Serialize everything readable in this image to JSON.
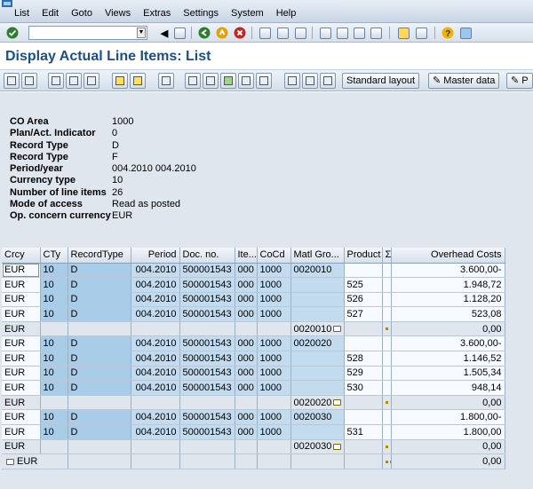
{
  "menu": [
    "List",
    "Edit",
    "Goto",
    "Views",
    "Extras",
    "Settings",
    "System",
    "Help"
  ],
  "title": "Display Actual Line Items: List",
  "appbar": {
    "standard_layout": "Standard layout",
    "master_data": "Master data",
    "cut_label": "P"
  },
  "header": [
    {
      "k": "CO Area",
      "v": "1000"
    },
    {
      "k": "Plan/Act. Indicator",
      "v": "0"
    },
    {
      "k": "Record Type",
      "v": "D"
    },
    {
      "k": "Record Type",
      "v": "F"
    },
    {
      "k": "Period/year",
      "v": "004.2010 004.2010"
    },
    {
      "k": "Currency type",
      "v": "10"
    },
    {
      "k": "Number of line items",
      "v": "26"
    },
    {
      "k": "Mode of access",
      "v": "Read as posted"
    },
    {
      "k": "Op. concern currency",
      "v": "EUR"
    }
  ],
  "columns": [
    "Crcy",
    "CTy",
    "RecordType",
    "Period",
    "Doc. no.",
    "Ite...",
    "CoCd",
    "Matl Gro...",
    "Product",
    "Σ",
    "Overhead Costs"
  ],
  "rows": [
    {
      "type": "row",
      "crcy": "EUR",
      "cty": "10",
      "rt": "D",
      "per": "004.2010",
      "doc": "500001543",
      "ite": "000",
      "cocd": "1000",
      "mg": "0020010",
      "prod": "",
      "val": "3.600,00-",
      "selected": true
    },
    {
      "type": "row",
      "crcy": "EUR",
      "cty": "10",
      "rt": "D",
      "per": "004.2010",
      "doc": "500001543",
      "ite": "000",
      "cocd": "1000",
      "mg": "",
      "prod": "525",
      "val": "1.948,72"
    },
    {
      "type": "row",
      "crcy": "EUR",
      "cty": "10",
      "rt": "D",
      "per": "004.2010",
      "doc": "500001543",
      "ite": "000",
      "cocd": "1000",
      "mg": "",
      "prod": "526",
      "val": "1.128,20"
    },
    {
      "type": "row",
      "crcy": "EUR",
      "cty": "10",
      "rt": "D",
      "per": "004.2010",
      "doc": "500001543",
      "ite": "000",
      "cocd": "1000",
      "mg": "",
      "prod": "527",
      "val": "523,08"
    },
    {
      "type": "sub",
      "crcy": "EUR",
      "mg": "0020010",
      "val": "0,00"
    },
    {
      "type": "row",
      "crcy": "EUR",
      "cty": "10",
      "rt": "D",
      "per": "004.2010",
      "doc": "500001543",
      "ite": "000",
      "cocd": "1000",
      "mg": "0020020",
      "prod": "",
      "val": "3.600,00-"
    },
    {
      "type": "row",
      "crcy": "EUR",
      "cty": "10",
      "rt": "D",
      "per": "004.2010",
      "doc": "500001543",
      "ite": "000",
      "cocd": "1000",
      "mg": "",
      "prod": "528",
      "val": "1.146,52"
    },
    {
      "type": "row",
      "crcy": "EUR",
      "cty": "10",
      "rt": "D",
      "per": "004.2010",
      "doc": "500001543",
      "ite": "000",
      "cocd": "1000",
      "mg": "",
      "prod": "529",
      "val": "1.505,34"
    },
    {
      "type": "row",
      "crcy": "EUR",
      "cty": "10",
      "rt": "D",
      "per": "004.2010",
      "doc": "500001543",
      "ite": "000",
      "cocd": "1000",
      "mg": "",
      "prod": "530",
      "val": "948,14"
    },
    {
      "type": "sub",
      "crcy": "EUR",
      "mg": "0020020",
      "val": "0,00"
    },
    {
      "type": "row",
      "crcy": "EUR",
      "cty": "10",
      "rt": "D",
      "per": "004.2010",
      "doc": "500001543",
      "ite": "000",
      "cocd": "1000",
      "mg": "0020030",
      "prod": "",
      "val": "1.800,00-"
    },
    {
      "type": "row",
      "crcy": "EUR",
      "cty": "10",
      "rt": "D",
      "per": "004.2010",
      "doc": "500001543",
      "ite": "000",
      "cocd": "1000",
      "mg": "",
      "prod": "531",
      "val": "1.800,00"
    },
    {
      "type": "sub",
      "crcy": "EUR",
      "mg": "0020030",
      "val": "0,00"
    },
    {
      "type": "total",
      "crcy": "EUR",
      "val": "0,00"
    }
  ]
}
